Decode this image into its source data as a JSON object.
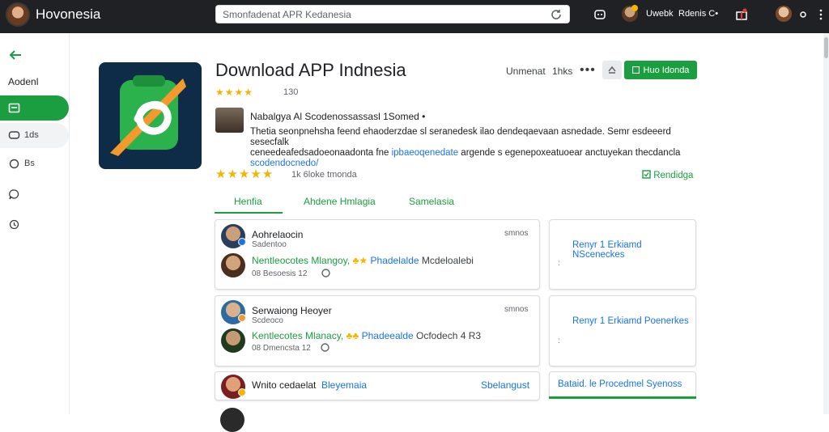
{
  "topbar": {
    "brand": "Hovonesia",
    "search_text": "Smonfadenat APR Kedanesia",
    "user_name": "Uwebk",
    "user_extra": "Rdenis C•"
  },
  "sidebar": {
    "label": "Aodenl",
    "items": [
      {
        "label": "",
        "icon": "app-icon"
      },
      {
        "label": "1ds",
        "icon": "chat-icon"
      },
      {
        "label": "Bs",
        "icon": "circle-icon"
      },
      {
        "label": "",
        "icon": "bubble-icon"
      },
      {
        "label": "",
        "icon": "refresh-icon"
      }
    ]
  },
  "app": {
    "title": "Download APP Indnesia",
    "rating_stars": "★★★★",
    "rating_count": "130",
    "link1": "Unmenat",
    "link2": "1hks",
    "more": "•••",
    "install": "Huo Idonda",
    "developer": "Nabalgya Al Scodenossassasl 1Somed •",
    "desc_line1": "Thetia seonpnehsha feend ehaoderzdae sl seranedesk ilao dendeqaevaan asnedade. Semr esdeeerd sesecfalk",
    "desc_line2a": "ceneedeafedsadoeonaadonta fne",
    "desc_link1": "ipbaeoqenedate",
    "desc_line2b": "argende s egenepoxeatuoear anctuyekan thecdancla",
    "desc_link2": "scodendocnedo/",
    "rating_big": "★★★★★",
    "rating_meta": "1k 6loke tmonda",
    "wishlist": "Rendidga"
  },
  "tabs": [
    "Henfia",
    "Ahdene Hmlagia",
    "Samelasia"
  ],
  "reviews": [
    {
      "name": "Aohrelaocin",
      "sub": "Sadentoo",
      "date": "smnos",
      "line_green": "Nentleocotes Mlangoy,",
      "line_blue": "Phadelalde",
      "line_gray": "Mcdeloalebi",
      "meta": "08 Besoesis 12"
    },
    {
      "name": "Serwaiong Heoyer",
      "sub": "Scdeoco",
      "date": "smnos",
      "line_green": "Kentlecotes Mlanacy,",
      "line_blue": "Phadeealde",
      "line_gray": "Ocfodech 4 R3",
      "meta": "08 Dmencsta 12"
    },
    {
      "name": "Wnito cedaelat",
      "blue": "Bleyemaia",
      "right": "Sbelangust"
    }
  ],
  "side_cards": [
    {
      "text": "Renyr 1 Erkiamd NSceneckes",
      "mark": ":"
    },
    {
      "text": "Renyr 1 Erkiamd Poenerkes",
      "mark": ":"
    },
    {
      "text": "Bataid. le Procedmel Syenoss",
      "mark": ""
    }
  ],
  "colors": {
    "accent": "#1a9e3f",
    "topbar": "#202124",
    "link": "#1a73e8",
    "star": "#f4b400"
  }
}
